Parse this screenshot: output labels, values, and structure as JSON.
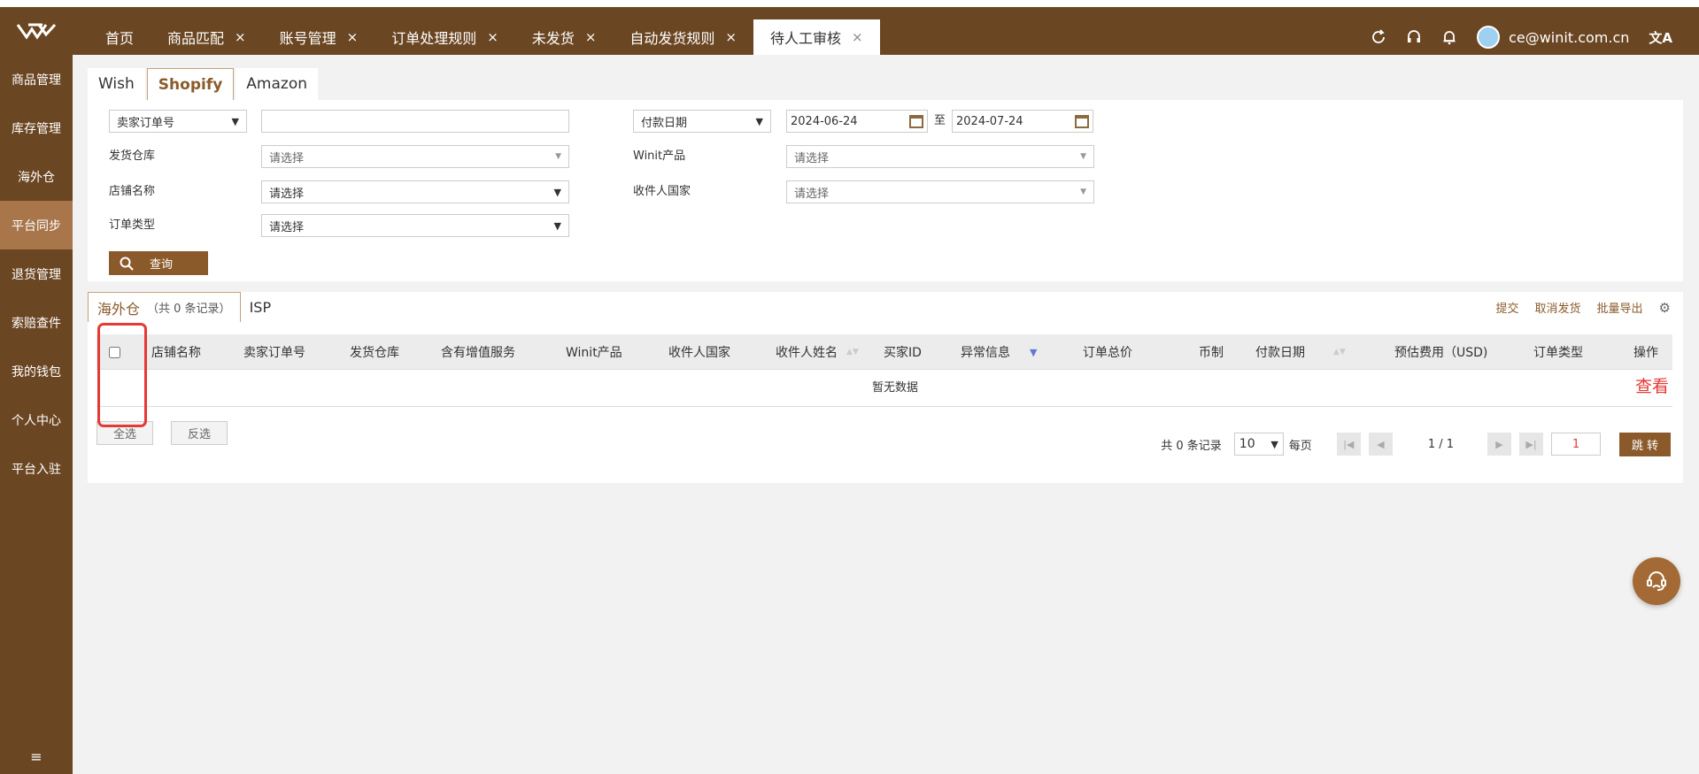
{
  "header": {
    "tabs": [
      {
        "label": "首页",
        "closable": false
      },
      {
        "label": "商品匹配",
        "closable": true
      },
      {
        "label": "账号管理",
        "closable": true
      },
      {
        "label": "订单处理规则",
        "closable": true
      },
      {
        "label": "未发货",
        "closable": true
      },
      {
        "label": "自动发货规则",
        "closable": true
      },
      {
        "label": "待人工审核",
        "closable": true,
        "active": true
      }
    ],
    "close_glyph": "×",
    "user": "ce@winit.com.cn",
    "icons": [
      "refresh-icon",
      "headset-icon",
      "bell-icon",
      "translate-icon"
    ],
    "translate_glyph": "文A"
  },
  "sidebar": {
    "items": [
      "商品管理",
      "库存管理",
      "海外仓",
      "平台同步",
      "退货管理",
      "索赔查件",
      "我的钱包",
      "个人中心",
      "平台入驻"
    ],
    "active_index": 3,
    "collapse_glyph": "≡"
  },
  "platform_tabs": [
    "Wish",
    "Shopify",
    "Amazon"
  ],
  "filter": {
    "order_type_select": "卖家订单号",
    "order_input": "",
    "date_type_select": "付款日期",
    "date_from": "2024-06-24",
    "date_sep": "至",
    "date_to": "2024-07-24",
    "warehouse_label": "发货仓库",
    "warehouse_value": "请选择",
    "product_label": "Winit产品",
    "product_value": "请选择",
    "store_label": "店铺名称",
    "store_value": "请选择",
    "country_label": "收件人国家",
    "country_value": "请选择",
    "ordertype_label": "订单类型",
    "ordertype_value": "请选择",
    "query_button": "查询"
  },
  "list": {
    "tab_main": "海外仓",
    "tab_count": "（共 0 条记录）",
    "tab_isp": "ISP",
    "actions": [
      "提交",
      "取消发货",
      "批量导出"
    ],
    "columns": [
      "店铺名称",
      "卖家订单号",
      "发货仓库",
      "含有增值服务",
      "Winit产品",
      "收件人国家",
      "收件人姓名",
      "买家ID",
      "异常信息",
      "订单总价",
      "币制",
      "付款日期",
      "预估费用（USD)",
      "订单类型",
      "操作"
    ],
    "empty_text": "暂无数据",
    "view_link": "查看",
    "select_all": "全选",
    "invert_select": "反选"
  },
  "pager": {
    "total": "共 0 条记录",
    "page_size": "10",
    "per_page_label": "每页",
    "page_info": "1 / 1",
    "page_input": "1",
    "jump_button": "跳 转"
  },
  "colors": {
    "brand": "#6b4622",
    "accent": "#8b5a2b",
    "active_side": "#a8764a",
    "highlight": "#e53935"
  }
}
